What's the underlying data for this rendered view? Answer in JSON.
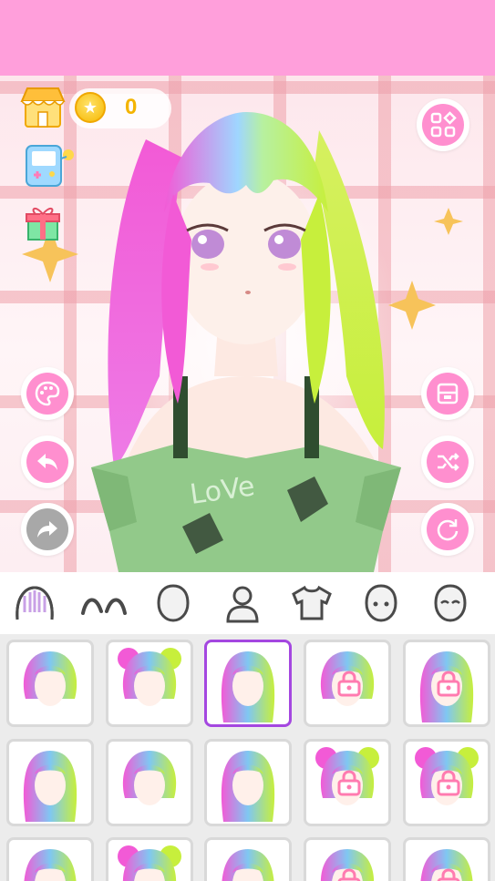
{
  "currency": {
    "coins": "0"
  },
  "colors": {
    "topbar": "#ff9fdb",
    "accent_pink": "#ff8fcf",
    "selected_border": "#a447e0",
    "hair_pink": "#f25ad6",
    "hair_green": "#c7ef3c",
    "hair_blue": "#7fc7f2"
  },
  "left_icons": [
    "shop-icon",
    "game-console-icon",
    "gift-icon"
  ],
  "buttons": [
    "palette-icon",
    "undo-icon",
    "redo-icon",
    "menu-grid-icon",
    "save-icon",
    "shuffle-icon",
    "reset-icon"
  ],
  "category_tabs": [
    "hair",
    "eyebrows",
    "face",
    "body",
    "clothes",
    "head",
    "expression"
  ],
  "hair_options": [
    {
      "style": "short-bob",
      "locked": false,
      "selected": false
    },
    {
      "style": "curly-bun",
      "locked": false,
      "selected": false
    },
    {
      "style": "twin-tails",
      "locked": false,
      "selected": true
    },
    {
      "style": "short-bob-2",
      "locked": true,
      "selected": false
    },
    {
      "style": "long-straight",
      "locked": true,
      "selected": false
    },
    {
      "style": "side-ponytail",
      "locked": false,
      "selected": false
    },
    {
      "style": "bob-wavy",
      "locked": false,
      "selected": false
    },
    {
      "style": "long-wavy",
      "locked": false,
      "selected": false
    },
    {
      "style": "curly-buns",
      "locked": true,
      "selected": false
    },
    {
      "style": "double-buns",
      "locked": true,
      "selected": false
    },
    {
      "style": "pigtails",
      "locked": false,
      "selected": false
    },
    {
      "style": "bangs-bun",
      "locked": false,
      "selected": false
    },
    {
      "style": "straight-bangs",
      "locked": false,
      "selected": false
    },
    {
      "style": "bob-locked",
      "locked": true,
      "selected": false
    },
    {
      "style": "long-locked",
      "locked": true,
      "selected": false
    }
  ]
}
